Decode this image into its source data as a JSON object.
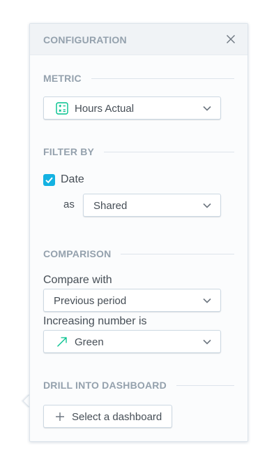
{
  "header": {
    "title": "CONFIGURATION",
    "close_icon": "close-icon"
  },
  "metric": {
    "section_title": "METRIC",
    "selected": "Hours Actual",
    "icon": "calculator-metric-icon"
  },
  "filter_by": {
    "section_title": "FILTER BY",
    "date": {
      "label": "Date",
      "checked": true
    },
    "as_label": "as",
    "as_selected": "Shared"
  },
  "comparison": {
    "section_title": "COMPARISON",
    "compare_with_label": "Compare with",
    "compare_with_selected": "Previous period",
    "increasing_label": "Increasing number is",
    "increasing_selected": "Green",
    "increasing_icon": "arrow-up-right-icon",
    "increasing_color": "#00c18d"
  },
  "drill": {
    "section_title": "DRILL INTO DASHBOARD",
    "button_label": "Select a dashboard",
    "button_icon": "plus-icon"
  },
  "colors": {
    "accent": "#14b2e2",
    "green": "#00c18d",
    "section_title": "#94a1ad"
  }
}
